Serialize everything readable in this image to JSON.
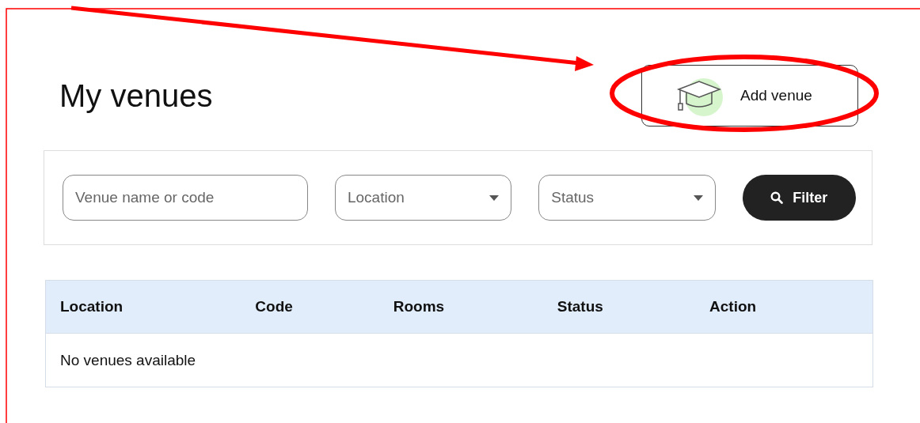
{
  "page": {
    "title": "My venues"
  },
  "add_button": {
    "label": "Add venue"
  },
  "filters": {
    "search": {
      "placeholder": "Venue name or code"
    },
    "location": {
      "placeholder": "Location"
    },
    "status": {
      "placeholder": "Status"
    },
    "button": {
      "label": "Filter"
    }
  },
  "table": {
    "columns": [
      "Location",
      "Code",
      "Rooms",
      "Status",
      "Action"
    ],
    "empty_message": "No venues available"
  }
}
